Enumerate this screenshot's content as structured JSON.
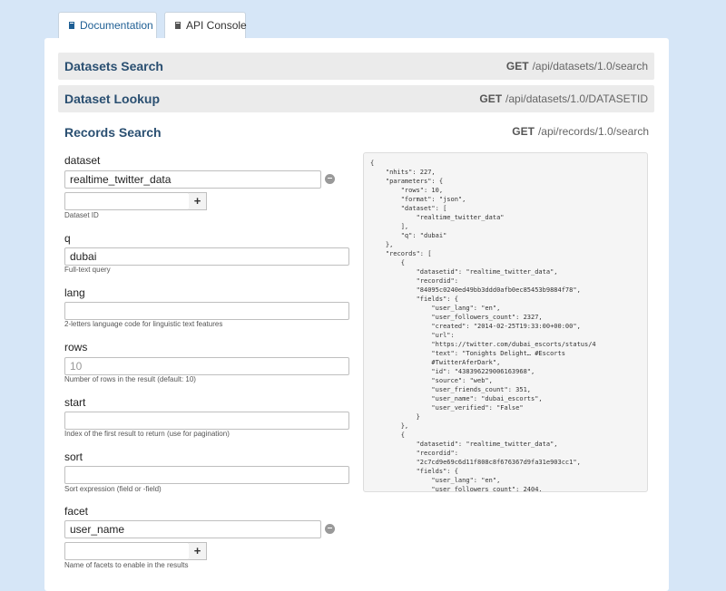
{
  "tabs": [
    {
      "label": "Documentation",
      "icon": "book-icon"
    },
    {
      "label": "API Console",
      "icon": "book-icon"
    }
  ],
  "sections": [
    {
      "title": "Datasets Search",
      "method": "GET",
      "path": "/api/datasets/1.0/search"
    },
    {
      "title": "Dataset Lookup",
      "method": "GET",
      "path": "/api/datasets/1.0/DATASETID"
    }
  ],
  "records": {
    "title": "Records Search",
    "method": "GET",
    "path": "/api/records/1.0/search"
  },
  "form": {
    "dataset": {
      "label": "dataset",
      "value": "realtime_twitter_data",
      "help": "Dataset ID",
      "remove": "–",
      "add": "+"
    },
    "q": {
      "label": "q",
      "value": "dubai",
      "help": "Full-text query"
    },
    "lang": {
      "label": "lang",
      "value": "",
      "help": "2-letters language code for linguistic text features"
    },
    "rows": {
      "label": "rows",
      "placeholder": "10",
      "help": "Number of rows in the result (default: 10)"
    },
    "start": {
      "label": "start",
      "value": "",
      "help": "Index of the first result to return (use for pagination)"
    },
    "sort": {
      "label": "sort",
      "value": "",
      "help": "Sort expression (field or -field)"
    },
    "facet": {
      "label": "facet",
      "value": "user_name",
      "help": "Name of facets to enable in the results",
      "remove": "–",
      "add": "+"
    }
  },
  "json_lines": [
    "{",
    "    \"nhits\": 227,",
    "    \"parameters\": {",
    "        \"rows\": 10,",
    "        \"format\": \"json\",",
    "        \"dataset\": [",
    "            \"realtime_twitter_data\"",
    "        ],",
    "        \"q\": \"dubai\"",
    "    },",
    "    \"records\": [",
    "        {",
    "            \"datasetid\": \"realtime_twitter_data\",",
    "            \"recordid\":",
    "            \"84095c0240ed49bb3ddd0afb0ec85453b9884f78\",",
    "            \"fields\": {",
    "                \"user_lang\": \"en\",",
    "                \"user_followers_count\": 2327,",
    "                \"created\": \"2014-02-25T19:33:00+00:00\",",
    "                \"url\":",
    "                \"https://twitter.com/dubai_escorts/status/4",
    "                \"text\": \"Tonights Delight… #Escorts",
    "                #TwitterAferDark\",",
    "                \"id\": \"438396229006163968\",",
    "                \"source\": \"web\",",
    "                \"user_friends_count\": 351,",
    "                \"user_name\": \"dubai_escorts\",",
    "                \"user_verified\": \"False\"",
    "            }",
    "        },",
    "        {",
    "            \"datasetid\": \"realtime_twitter_data\",",
    "            \"recordid\":",
    "            \"2c7cd9e69c6d11f808c8f676367d9fa31e903cc1\",",
    "            \"fields\": {",
    "                \"user_lang\": \"en\",",
    "                \"user_followers_count\": 2404,"
  ]
}
